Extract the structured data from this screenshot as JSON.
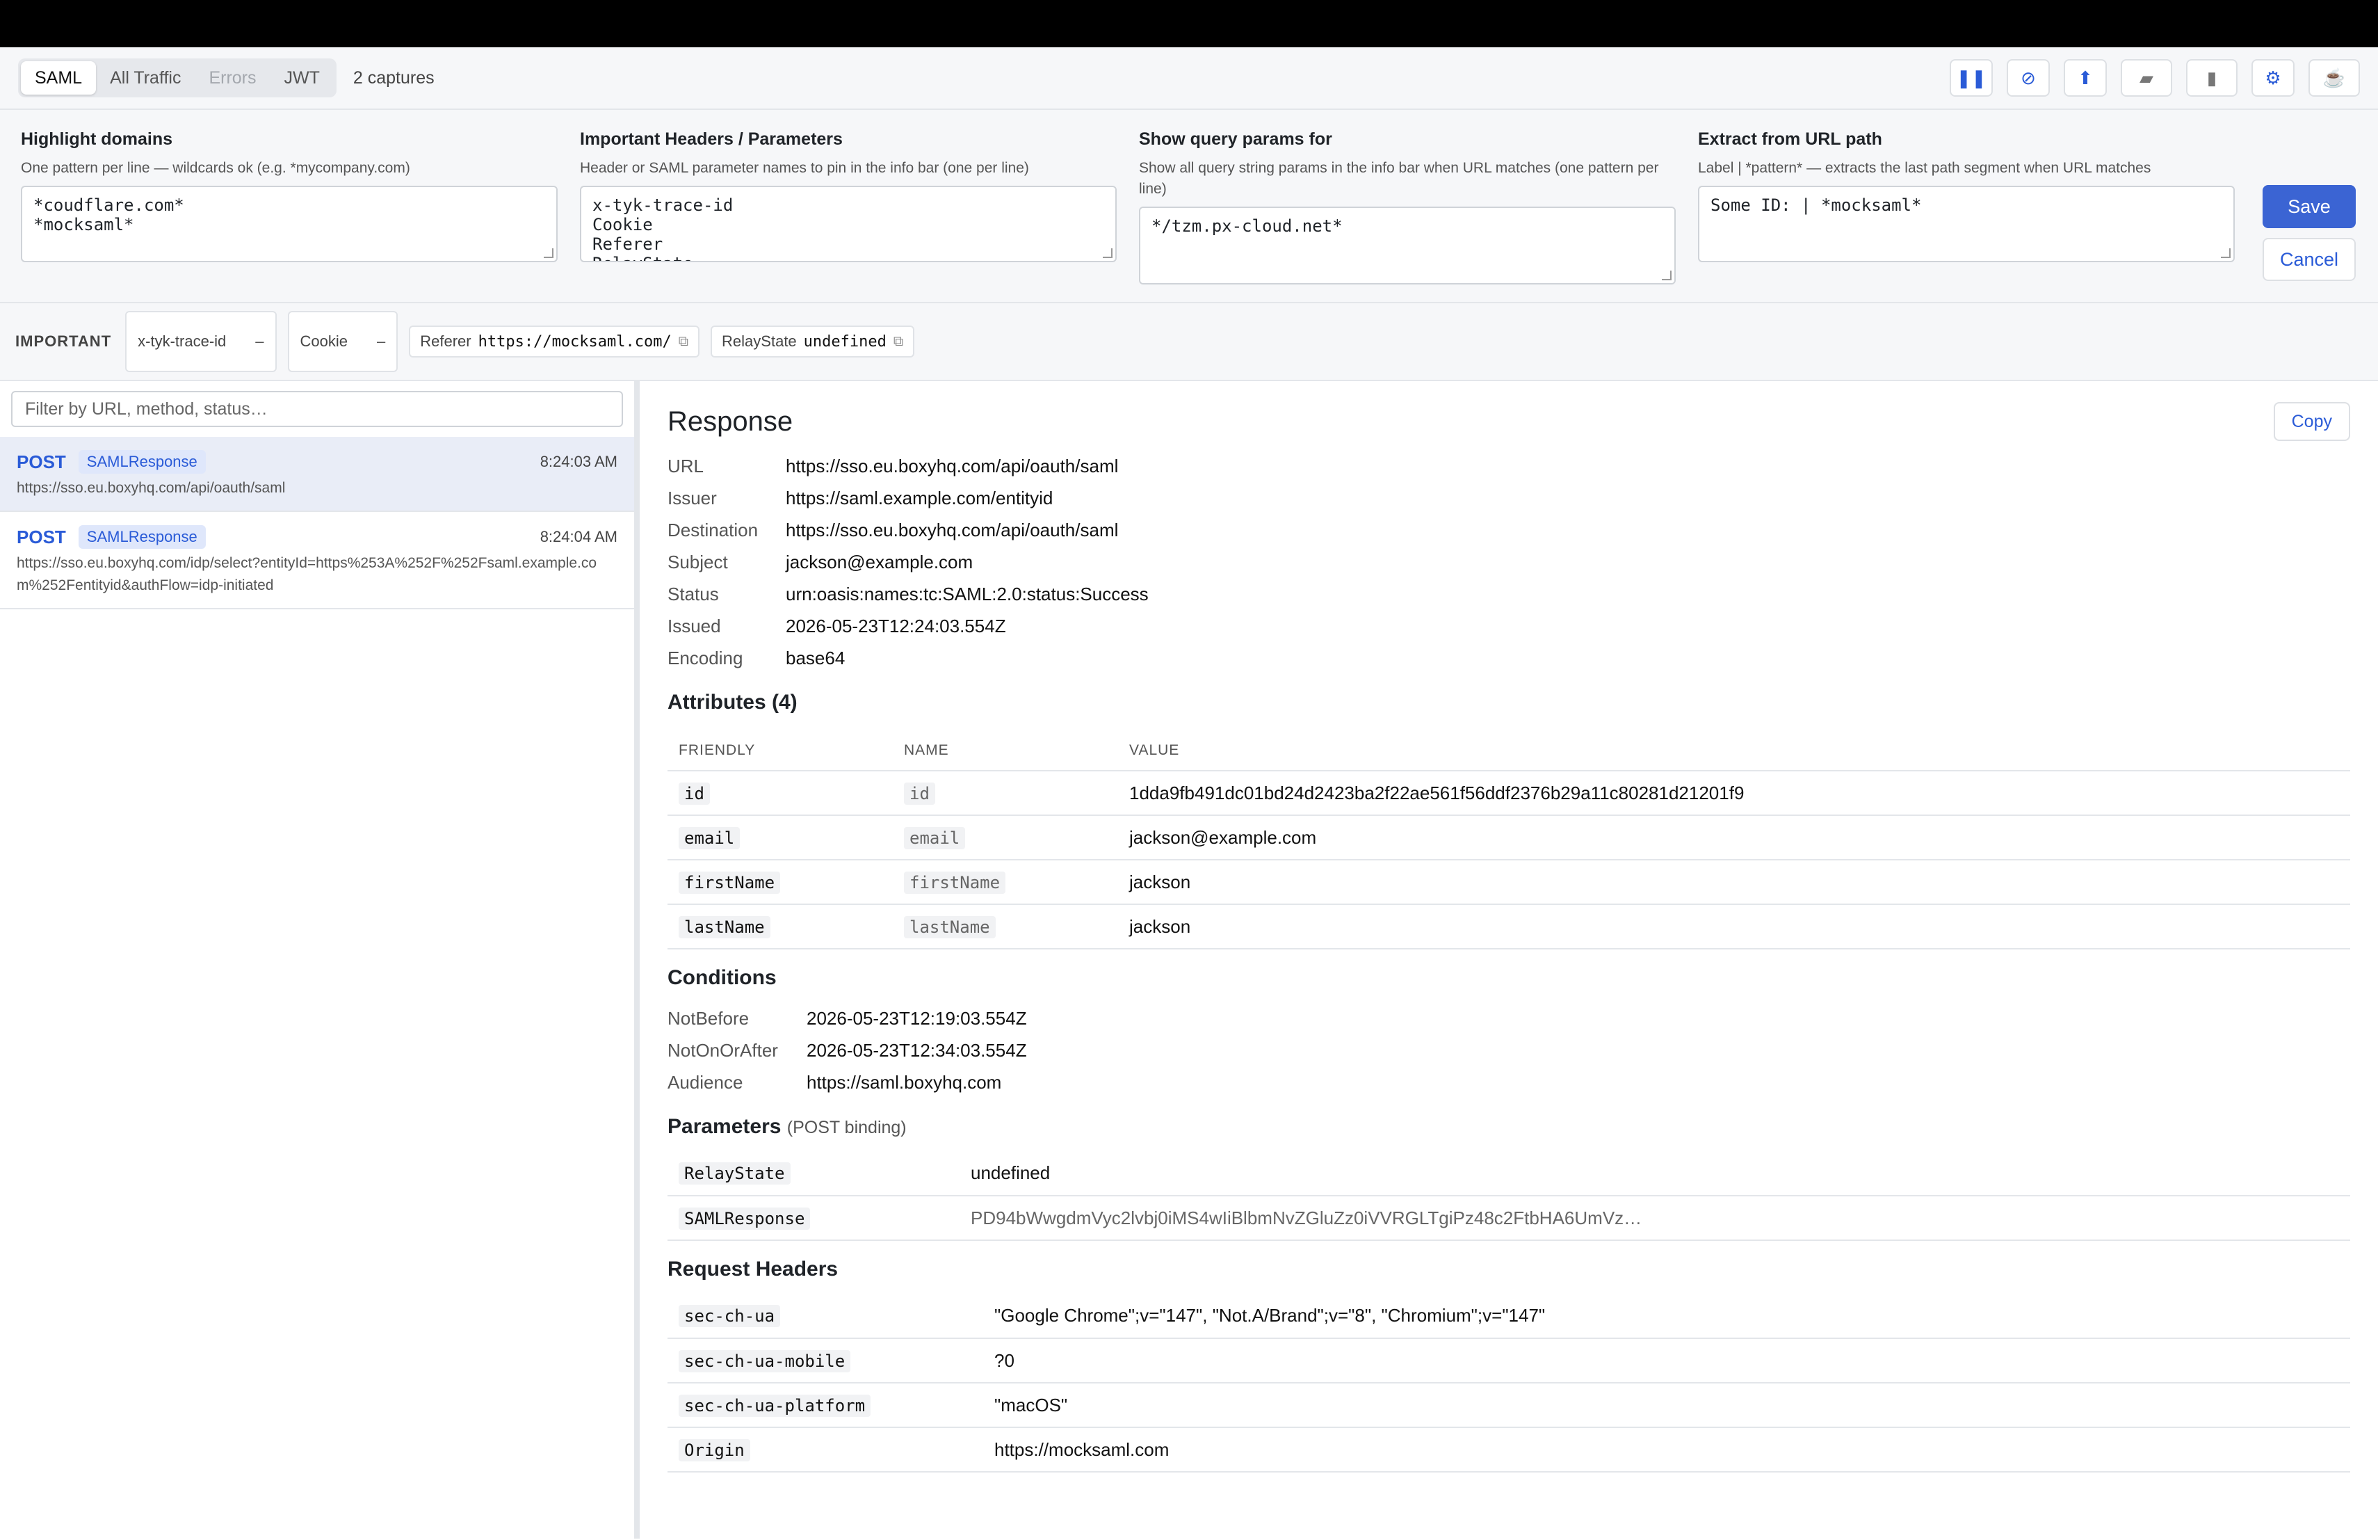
{
  "toolbar": {
    "tabs": [
      "SAML",
      "All Traffic",
      "Errors",
      "JWT"
    ],
    "captures": "2 captures",
    "icons": [
      "pause-icon",
      "block-icon",
      "upload-icon",
      "folder-icon",
      "document-icon",
      "gear-icon",
      "coffee-icon"
    ]
  },
  "config": {
    "highlight": {
      "title": "Highlight domains",
      "desc": "One pattern per line — wildcards ok (e.g. *mycompany.com)",
      "value": "*coudflare.com*\n*mocksaml*"
    },
    "headers": {
      "title": "Important Headers / Parameters",
      "desc": "Header or SAML parameter names to pin in the info bar (one per line)",
      "value": "x-tyk-trace-id\nCookie\nReferer\nRelayState"
    },
    "query": {
      "title": "Show query params for",
      "desc": "Show all query string params in the info bar when URL matches (one pattern per line)",
      "value": "*/tzm.px-cloud.net*"
    },
    "extract": {
      "title": "Extract from URL path",
      "desc": "Label | *pattern* — extracts the last path segment when URL matches",
      "value": "Some ID: | *mocksaml*"
    },
    "save": "Save",
    "cancel": "Cancel"
  },
  "important": {
    "label": "IMPORTANT",
    "chips": [
      {
        "name": "x-tyk-trace-id",
        "value": "–"
      },
      {
        "name": "Cookie",
        "value": "–"
      }
    ],
    "referer": {
      "name": "Referer",
      "value": "https://mocksaml.com/"
    },
    "relay": {
      "name": "RelayState",
      "value": "undefined"
    }
  },
  "filter": {
    "placeholder": "Filter by URL, method, status…"
  },
  "requests": [
    {
      "method": "POST",
      "badge": "SAMLResponse",
      "time": "8:24:03 AM",
      "url": "https://sso.eu.boxyhq.com/api/oauth/saml"
    },
    {
      "method": "POST",
      "badge": "SAMLResponse",
      "time": "8:24:04 AM",
      "url": "https://sso.eu.boxyhq.com/idp/select?entityId=https%253A%252F%252Fsaml.example.com%252Fentityid&authFlow=idp-initiated"
    }
  ],
  "response": {
    "title": "Response",
    "copy": "Copy",
    "fields": [
      [
        "URL",
        "https://sso.eu.boxyhq.com/api/oauth/saml"
      ],
      [
        "Issuer",
        "https://saml.example.com/entityid"
      ],
      [
        "Destination",
        "https://sso.eu.boxyhq.com/api/oauth/saml"
      ],
      [
        "Subject",
        "jackson@example.com"
      ],
      [
        "Status",
        "urn:oasis:names:tc:SAML:2.0:status:Success"
      ],
      [
        "Issued",
        "2026-05-23T12:24:03.554Z"
      ],
      [
        "Encoding",
        "base64"
      ]
    ],
    "attributes_title": "Attributes (4)",
    "attr_headers": [
      "FRIENDLY",
      "NAME",
      "VALUE"
    ],
    "attributes": [
      [
        "id",
        "id",
        "1dda9fb491dc01bd24d2423ba2f22ae561f56ddf2376b29a11c80281d21201f9"
      ],
      [
        "email",
        "email",
        "jackson@example.com"
      ],
      [
        "firstName",
        "firstName",
        "jackson"
      ],
      [
        "lastName",
        "lastName",
        "jackson"
      ]
    ],
    "conditions_title": "Conditions",
    "conditions": [
      [
        "NotBefore",
        "2026-05-23T12:19:03.554Z"
      ],
      [
        "NotOnOrAfter",
        "2026-05-23T12:34:03.554Z"
      ],
      [
        "Audience",
        "https://saml.boxyhq.com"
      ]
    ],
    "params_title": "Parameters",
    "params_sub": "(POST binding)",
    "params": [
      [
        "RelayState",
        "undefined"
      ],
      [
        "SAMLResponse",
        "PD94bWwgdmVyc2lvbj0iMS4wIiBlbmNvZGluZz0iVVRGLTgiPz48c2FtbHA6UmVz…"
      ]
    ],
    "headers_title": "Request Headers",
    "headers": [
      [
        "sec-ch-ua",
        "\"Google Chrome\";v=\"147\", \"Not.A/Brand\";v=\"8\", \"Chromium\";v=\"147\""
      ],
      [
        "sec-ch-ua-mobile",
        "?0"
      ],
      [
        "sec-ch-ua-platform",
        "\"macOS\""
      ],
      [
        "Origin",
        "https://mocksaml.com"
      ]
    ]
  }
}
